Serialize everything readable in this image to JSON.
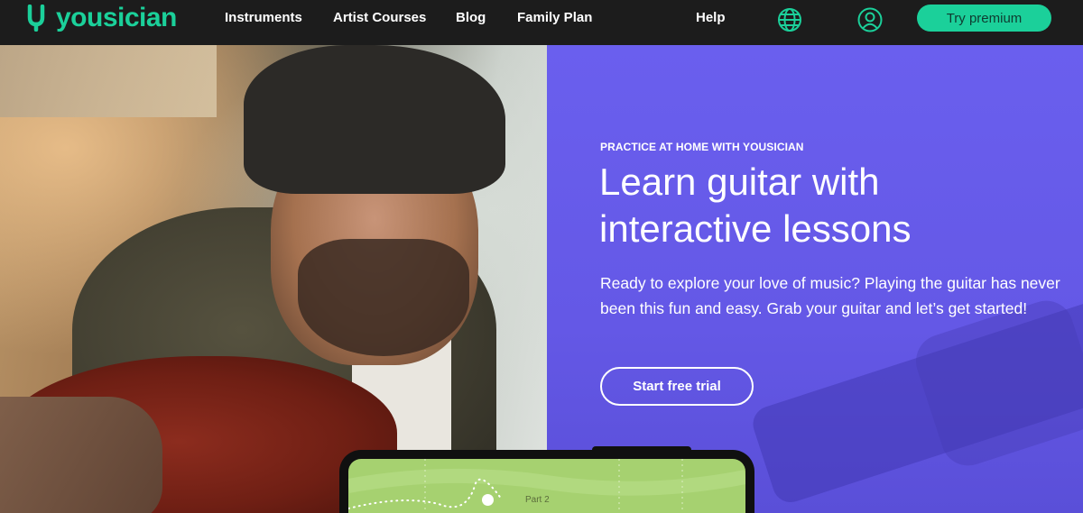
{
  "brand": {
    "name": "yousician",
    "color": "#1bd09a"
  },
  "nav": {
    "links": [
      "Instruments",
      "Artist Courses",
      "Blog",
      "Family Plan",
      "Help"
    ],
    "icons": [
      "globe-icon",
      "user-account-icon"
    ],
    "cta": "Try premium"
  },
  "hero": {
    "eyebrow": "PRACTICE AT HOME WITH YOUSICIAN",
    "headline_line1": "Learn guitar with",
    "headline_line2": "interactive lessons",
    "body": "Ready to explore your love of music? Playing the guitar has never been this fun and easy. Grab your guitar and let’s get started!",
    "cta": "Start free trial",
    "background_color": "#6a5fee"
  },
  "phone": {
    "part_label": "Part 2"
  }
}
